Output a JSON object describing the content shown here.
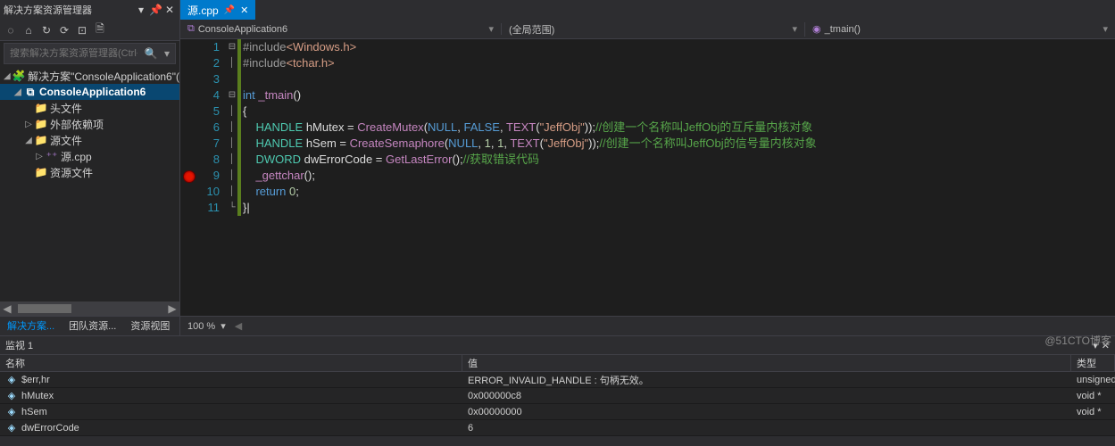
{
  "solExplorer": {
    "title": "解决方案资源管理器",
    "searchPlaceholder": "搜索解决方案资源管理器(Ctrl+;)",
    "nodes": {
      "solution": "解决方案\"ConsoleApplication6\"(",
      "project": "ConsoleApplication6",
      "headers": "头文件",
      "external": "外部依赖项",
      "sources": "源文件",
      "sourceCpp": "源.cpp",
      "resources": "资源文件"
    },
    "bottomTabs": {
      "sol": "解决方案...",
      "team": "团队资源...",
      "resview": "资源视图"
    }
  },
  "editor": {
    "tabLabel": "源.cpp",
    "ctxLeft": "ConsoleApplication6",
    "ctxMid": "(全局范围)",
    "ctxRight": "_tmain()",
    "zoom": "100 %",
    "lines": [
      {
        "n": 1,
        "fold": "⊟",
        "chg": true,
        "html": "<span class='pp'>#include</span><span class='str'>&lt;Windows.h&gt;</span>"
      },
      {
        "n": 2,
        "fold": "│",
        "chg": true,
        "html": "<span class='pp'>#include</span><span class='str'>&lt;tchar.h&gt;</span>"
      },
      {
        "n": 3,
        "fold": "",
        "chg": true,
        "html": ""
      },
      {
        "n": 4,
        "fold": "⊟",
        "chg": true,
        "html": "<span class='kw'>int</span> <span class='fn'>_tmain</span>()"
      },
      {
        "n": 5,
        "fold": "│",
        "chg": true,
        "html": "{"
      },
      {
        "n": 6,
        "fold": "│",
        "chg": true,
        "html": "    <span class='type'>HANDLE</span> hMutex = <span class='fn'>CreateMutex</span>(<span class='kw'>NULL</span>, <span class='kw'>FALSE</span>, <span class='fn'>TEXT</span>(<span class='str'>\"JeffObj\"</span>));<span class='cmt'>//创建一个名称叫JeffObj的互斥量内核对象</span>"
      },
      {
        "n": 7,
        "fold": "│",
        "chg": true,
        "html": "    <span class='type'>HANDLE</span> hSem = <span class='fn'>CreateSemaphore</span>(<span class='kw'>NULL</span>, <span class='num'>1</span>, <span class='num'>1</span>, <span class='fn'>TEXT</span>(<span class='str'>\"JeffObj\"</span>));<span class='cmt'>//创建一个名称叫JeffObj的信号量内核对象</span>"
      },
      {
        "n": 8,
        "fold": "│",
        "chg": true,
        "html": "    <span class='type'>DWORD</span> dwErrorCode = <span class='fn'>GetLastError</span>();<span class='cmt'>//获取错误代码</span>"
      },
      {
        "n": 9,
        "fold": "│",
        "chg": true,
        "bp": true,
        "html": "    <span class='fn'>_gettchar</span>();"
      },
      {
        "n": 10,
        "fold": "│",
        "chg": true,
        "html": "    <span class='kw'>return</span> <span class='num'>0</span>;"
      },
      {
        "n": 11,
        "fold": "└",
        "chg": true,
        "html": "}|"
      }
    ]
  },
  "watch": {
    "title": "监视 1",
    "cols": {
      "name": "名称",
      "value": "值",
      "type": "类型"
    },
    "rows": [
      {
        "name": "$err,hr",
        "value": "ERROR_INVALID_HANDLE : 句柄无效。",
        "type": "unsigned"
      },
      {
        "name": "hMutex",
        "value": "0x000000c8",
        "type": "void *"
      },
      {
        "name": "hSem",
        "value": "0x00000000",
        "type": "void *"
      },
      {
        "name": "dwErrorCode",
        "value": "6",
        "type": ""
      }
    ]
  },
  "watermark": "@51CTO博客"
}
